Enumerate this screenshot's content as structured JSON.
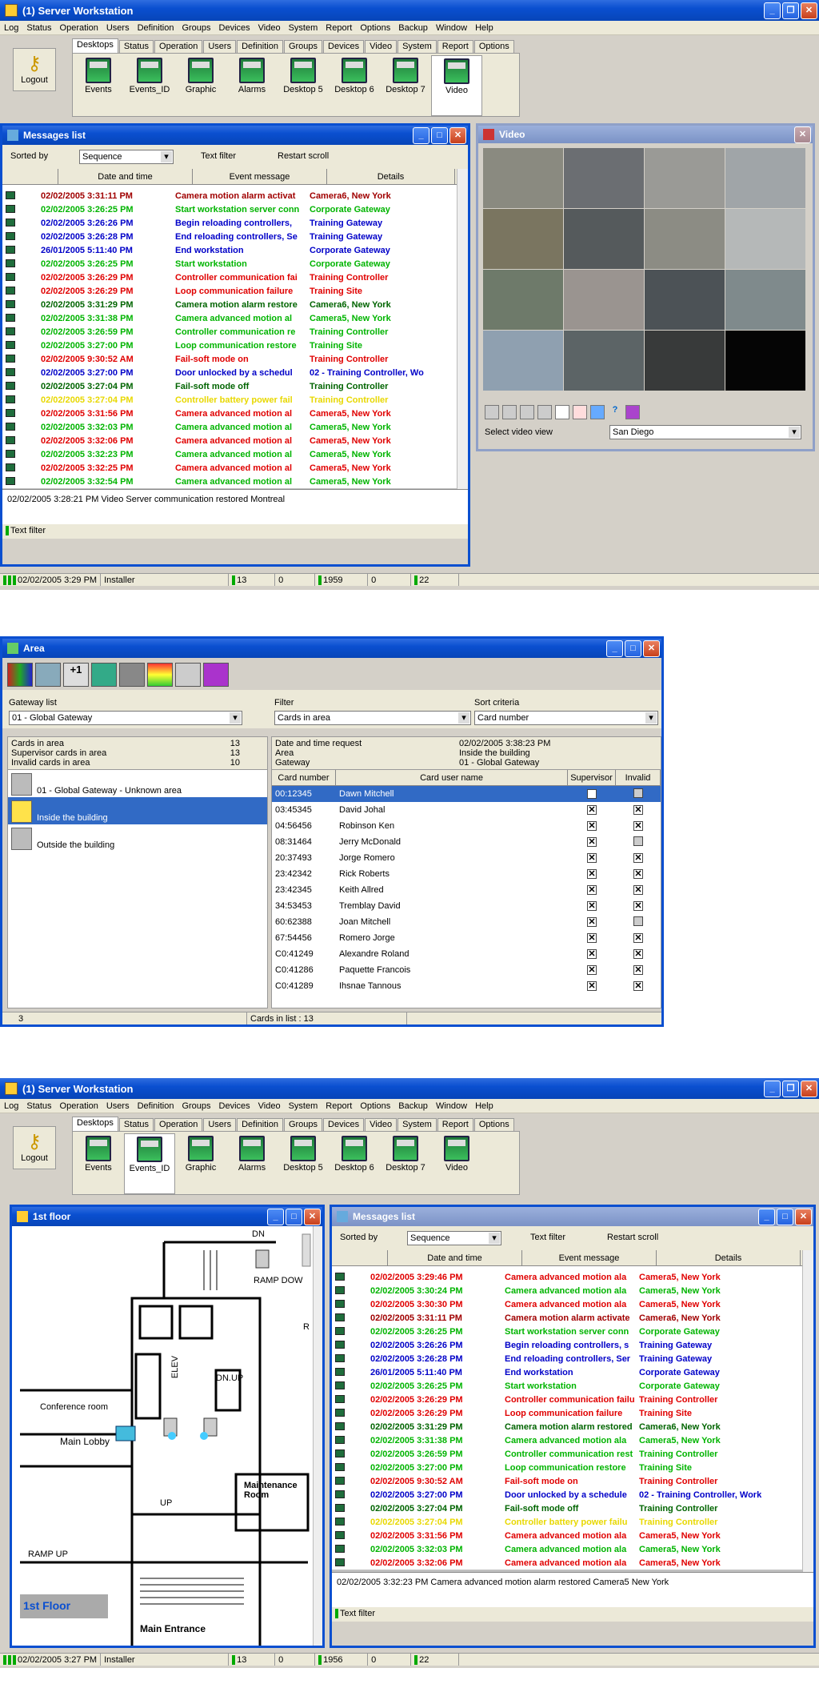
{
  "app1": {
    "title": "(1) Server Workstation",
    "menu": [
      "Log",
      "Status",
      "Operation",
      "Users",
      "Definition",
      "Groups",
      "Devices",
      "Video",
      "System",
      "Report",
      "Options",
      "Backup",
      "Window",
      "Help"
    ],
    "tabs": [
      "Desktops",
      "Status",
      "Operation",
      "Users",
      "Definition",
      "Groups",
      "Devices",
      "Video",
      "System",
      "Report",
      "Options"
    ],
    "logout": "Logout",
    "toolbar": [
      "Events",
      "Events_ID",
      "Graphic",
      "Alarms",
      "Desktop 5",
      "Desktop 6",
      "Desktop 7",
      "Video"
    ]
  },
  "messages1": {
    "title": "Messages list",
    "sorted_by_label": "Sorted by",
    "sorted_by_value": "Sequence",
    "text_filter": "Text filter",
    "restart_scroll": "Restart scroll",
    "headers": [
      "Date and time",
      "Event message",
      "Details"
    ],
    "rows": [
      {
        "d": "02/02/2005 3:31:11 PM",
        "e": "Camera motion alarm activat",
        "t": "Camera6, New York",
        "c": "dred"
      },
      {
        "d": "02/02/2005 3:26:25 PM",
        "e": "Start workstation server conn",
        "t": "Corporate Gateway",
        "c": "green"
      },
      {
        "d": "02/02/2005 3:26:26 PM",
        "e": "Begin reloading controllers, ",
        "t": "Training Gateway",
        "c": "blue"
      },
      {
        "d": "02/02/2005 3:26:28 PM",
        "e": "End reloading controllers, Se",
        "t": "Training Gateway",
        "c": "blue"
      },
      {
        "d": "26/01/2005 5:11:40 PM",
        "e": "End workstation",
        "t": "Corporate Gateway",
        "c": "blue"
      },
      {
        "d": "02/02/2005 3:26:25 PM",
        "e": "Start workstation",
        "t": "Corporate Gateway",
        "c": "green"
      },
      {
        "d": "02/02/2005 3:26:29 PM",
        "e": "Controller communication fai",
        "t": "Training Controller",
        "c": "red"
      },
      {
        "d": "02/02/2005 3:26:29 PM",
        "e": "Loop communication failure",
        "t": "Training Site",
        "c": "red"
      },
      {
        "d": "02/02/2005 3:31:29 PM",
        "e": "Camera motion alarm restore",
        "t": "Camera6, New York",
        "c": "dgreen"
      },
      {
        "d": "02/02/2005 3:31:38 PM",
        "e": "Camera advanced motion al",
        "t": "Camera5, New York",
        "c": "green"
      },
      {
        "d": "02/02/2005 3:26:59 PM",
        "e": "Controller communication re",
        "t": "Training Controller",
        "c": "green"
      },
      {
        "d": "02/02/2005 3:27:00 PM",
        "e": "Loop communication restore",
        "t": "Training Site",
        "c": "green"
      },
      {
        "d": "02/02/2005 9:30:52 AM",
        "e": "Fail-soft mode on",
        "t": "Training Controller",
        "c": "red"
      },
      {
        "d": "02/02/2005 3:27:00 PM",
        "e": "Door unlocked by a schedul",
        "t": "02 - Training Controller, Wo",
        "c": "blue"
      },
      {
        "d": "02/02/2005 3:27:04 PM",
        "e": "Fail-soft mode off",
        "t": "Training Controller",
        "c": "dgreen"
      },
      {
        "d": "02/02/2005 3:27:04 PM",
        "e": "Controller battery power fail",
        "t": "Training Controller",
        "c": "yellow"
      },
      {
        "d": "02/02/2005 3:31:56 PM",
        "e": "Camera advanced motion al",
        "t": "Camera5, New York",
        "c": "red"
      },
      {
        "d": "02/02/2005 3:32:03 PM",
        "e": "Camera advanced motion al",
        "t": "Camera5, New York",
        "c": "green"
      },
      {
        "d": "02/02/2005 3:32:06 PM",
        "e": "Camera advanced motion al",
        "t": "Camera5, New York",
        "c": "red"
      },
      {
        "d": "02/02/2005 3:32:23 PM",
        "e": "Camera advanced motion al",
        "t": "Camera5, New York",
        "c": "green"
      },
      {
        "d": "02/02/2005 3:32:25 PM",
        "e": "Camera advanced motion al",
        "t": "Camera5, New York",
        "c": "red"
      },
      {
        "d": "02/02/2005 3:32:54 PM",
        "e": "Camera advanced motion al",
        "t": "Camera5, New York",
        "c": "green"
      },
      {
        "d": "02/02/2005 3:28:21 PM",
        "e": "Video Server communication",
        "t": "Montreal",
        "c": "sel"
      }
    ],
    "detail": "02/02/2005 3:28:21 PM  Video Server communication restored  Montreal",
    "footer": "Text filter"
  },
  "video": {
    "title": "Video",
    "select_label": "Select video view",
    "select_value": "San Diego"
  },
  "status1": {
    "time": "02/02/2005 3:29 PM",
    "user": "Installer",
    "a": "13",
    "b": "0",
    "c": "1959",
    "d": "0",
    "e": "22"
  },
  "area": {
    "title": "Area",
    "gateway_label": "Gateway list",
    "gateway_value": "01 - Global Gateway",
    "filter_label": "Filter",
    "filter_value": "Cards in area",
    "sort_label": "Sort criteria",
    "sort_value": "Card number",
    "stats": [
      {
        "k": "Cards in area",
        "v": "13"
      },
      {
        "k": "Supervisor cards in area",
        "v": "13"
      },
      {
        "k": "Invalid cards in area",
        "v": "10"
      }
    ],
    "req": [
      {
        "k": "Date and time request",
        "v": "02/02/2005 3:38:23 PM"
      },
      {
        "k": "Area",
        "v": "Inside the building"
      },
      {
        "k": "Gateway",
        "v": "01 - Global Gateway"
      }
    ],
    "tree": [
      "01 - Global Gateway - Unknown area",
      "Inside the building",
      "Outside the building"
    ],
    "headers": [
      "Card number",
      "Card user name",
      "Supervisor",
      "Invalid"
    ],
    "cards": [
      {
        "n": "00:12345",
        "u": "Dawn Mitchell",
        "s": true,
        "i": false
      },
      {
        "n": "03:45345",
        "u": "David Johal",
        "s": true,
        "i": true
      },
      {
        "n": "04:56456",
        "u": "Robinson Ken",
        "s": true,
        "i": true
      },
      {
        "n": "08:31464",
        "u": "Jerry McDonald",
        "s": true,
        "i": false
      },
      {
        "n": "20:37493",
        "u": "Jorge Romero",
        "s": true,
        "i": true
      },
      {
        "n": "23:42342",
        "u": "Rick Roberts",
        "s": true,
        "i": true
      },
      {
        "n": "23:42345",
        "u": "Keith Allred",
        "s": true,
        "i": true
      },
      {
        "n": "34:53453",
        "u": "Tremblay David",
        "s": true,
        "i": true
      },
      {
        "n": "60:62388",
        "u": "Joan Mitchell",
        "s": true,
        "i": false
      },
      {
        "n": "67:54456",
        "u": "Romero Jorge",
        "s": true,
        "i": true
      },
      {
        "n": "C0:41249",
        "u": "Alexandre Roland",
        "s": true,
        "i": true
      },
      {
        "n": "C0:41286",
        "u": "Paquette Francois",
        "s": true,
        "i": true
      },
      {
        "n": "C0:41289",
        "u": "Ihsnae Tannous",
        "s": true,
        "i": true
      }
    ],
    "footer_count": "3",
    "footer_cards": "Cards in list : 13"
  },
  "floor": {
    "title": "1st floor",
    "labels": {
      "dn": "DN",
      "ramp_down": "RAMP DOW",
      "elev": "ELEV",
      "dnup": "DN.UP",
      "conf": "Conference room",
      "lobby": "Main Lobby",
      "up": "UP",
      "maint": "Maintenance Room",
      "ramp_up": "RAMP UP",
      "entrance": "Main Entrance",
      "floor": "1st Floor",
      "r": "R"
    }
  },
  "messages2": {
    "title": "Messages list",
    "detail": "02/02/2005 3:32:23 PM  Camera advanced motion alarm restored  Camera5  New York",
    "rows": [
      {
        "d": "02/02/2005 3:29:46 PM",
        "e": "Camera advanced motion ala",
        "t": "Camera5, New York",
        "c": "red"
      },
      {
        "d": "02/02/2005 3:30:24 PM",
        "e": "Camera advanced motion ala",
        "t": "Camera5, New York",
        "c": "green"
      },
      {
        "d": "02/02/2005 3:30:30 PM",
        "e": "Camera advanced motion ala",
        "t": "Camera5, New York",
        "c": "red"
      },
      {
        "d": "02/02/2005 3:31:11 PM",
        "e": "Camera motion alarm activate",
        "t": "Camera6, New York",
        "c": "dred"
      },
      {
        "d": "02/02/2005 3:26:25 PM",
        "e": "Start workstation server conn",
        "t": "Corporate Gateway",
        "c": "green"
      },
      {
        "d": "02/02/2005 3:26:26 PM",
        "e": "Begin reloading controllers, s",
        "t": "Training Gateway",
        "c": "blue"
      },
      {
        "d": "02/02/2005 3:26:28 PM",
        "e": "End reloading controllers, Ser",
        "t": "Training Gateway",
        "c": "blue"
      },
      {
        "d": "26/01/2005 5:11:40 PM",
        "e": "End workstation",
        "t": "Corporate Gateway",
        "c": "blue"
      },
      {
        "d": "02/02/2005 3:26:25 PM",
        "e": "Start workstation",
        "t": "Corporate Gateway",
        "c": "green"
      },
      {
        "d": "02/02/2005 3:26:29 PM",
        "e": "Controller communication failu",
        "t": "Training Controller",
        "c": "red"
      },
      {
        "d": "02/02/2005 3:26:29 PM",
        "e": "Loop communication failure",
        "t": "Training Site",
        "c": "red"
      },
      {
        "d": "02/02/2005 3:31:29 PM",
        "e": "Camera motion alarm restored",
        "t": "Camera6, New York",
        "c": "dgreen"
      },
      {
        "d": "02/02/2005 3:31:38 PM",
        "e": "Camera advanced motion ala",
        "t": "Camera5, New York",
        "c": "green"
      },
      {
        "d": "02/02/2005 3:26:59 PM",
        "e": "Controller communication rest",
        "t": "Training Controller",
        "c": "green"
      },
      {
        "d": "02/02/2005 3:27:00 PM",
        "e": "Loop communication restore",
        "t": "Training Site",
        "c": "green"
      },
      {
        "d": "02/02/2005 9:30:52 AM",
        "e": "Fail-soft mode on",
        "t": "Training Controller",
        "c": "red"
      },
      {
        "d": "02/02/2005 3:27:00 PM",
        "e": "Door unlocked by a schedule",
        "t": "02 - Training Controller, Work",
        "c": "blue"
      },
      {
        "d": "02/02/2005 3:27:04 PM",
        "e": "Fail-soft mode off",
        "t": "Training Controller",
        "c": "dgreen"
      },
      {
        "d": "02/02/2005 3:27:04 PM",
        "e": "Controller battery power failu",
        "t": "Training Controller",
        "c": "yellow"
      },
      {
        "d": "02/02/2005 3:31:56 PM",
        "e": "Camera advanced motion ala",
        "t": "Camera5, New York",
        "c": "red"
      },
      {
        "d": "02/02/2005 3:32:03 PM",
        "e": "Camera advanced motion ala",
        "t": "Camera5, New York",
        "c": "green"
      },
      {
        "d": "02/02/2005 3:32:06 PM",
        "e": "Camera advanced motion ala",
        "t": "Camera5, New York",
        "c": "red"
      },
      {
        "d": "02/02/2005 3:32:23 PM",
        "e": "Camera advanced motion ala",
        "t": "Camera5, New York",
        "c": "sel"
      }
    ]
  },
  "status2": {
    "time": "02/02/2005 3:27 PM",
    "user": "Installer",
    "a": "13",
    "b": "0",
    "c": "1956",
    "d": "0",
    "e": "22"
  }
}
